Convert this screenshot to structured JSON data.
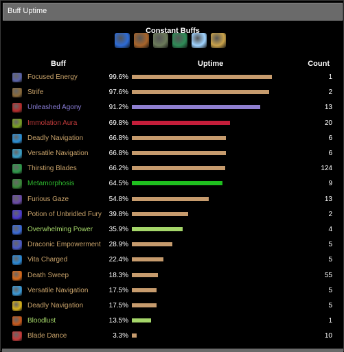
{
  "window": {
    "title": "Buff Uptime"
  },
  "constant": {
    "title": "Constant Buffs",
    "icons": [
      {
        "name": "arcane-swirl-icon",
        "color": "#2d6bd6"
      },
      {
        "name": "demon-face-icon",
        "color": "#a8642a"
      },
      {
        "name": "stone-pillar-icon",
        "color": "#6b7a5a"
      },
      {
        "name": "green-orb-icon",
        "color": "#2e8b57"
      },
      {
        "name": "ice-crystal-icon",
        "color": "#9fd3ff"
      },
      {
        "name": "golden-hoof-icon",
        "color": "#c9a24a"
      }
    ]
  },
  "table": {
    "headers": {
      "buff": "Buff",
      "uptime": "Uptime",
      "count": "Count"
    },
    "rows": [
      {
        "name": "Focused Energy",
        "pct": "99.6%",
        "count": "1",
        "uptime": 0.996,
        "name_color": "#c8a26a",
        "bar_color": "#c69b6d",
        "icon": "focused-energy-icon",
        "icon_color": "#5a63a8"
      },
      {
        "name": "Strife",
        "pct": "97.6%",
        "count": "2",
        "uptime": 0.976,
        "name_color": "#c8a26a",
        "bar_color": "#c69b6d",
        "icon": "strife-icon",
        "icon_color": "#8a6a3a"
      },
      {
        "name": "Unleashed Agony",
        "pct": "91.2%",
        "count": "13",
        "uptime": 0.912,
        "name_color": "#8a7ed8",
        "bar_color": "#8f7fd0",
        "icon": "unleashed-agony-icon",
        "icon_color": "#b52b2b"
      },
      {
        "name": "Immolation Aura",
        "pct": "69.8%",
        "count": "20",
        "uptime": 0.698,
        "name_color": "#c23b3b",
        "bar_color": "#c41e3a",
        "icon": "immolation-aura-icon",
        "icon_color": "#7aa024"
      },
      {
        "name": "Deadly Navigation",
        "pct": "66.8%",
        "count": "6",
        "uptime": 0.668,
        "name_color": "#c8a26a",
        "bar_color": "#c69b6d",
        "icon": "deadly-navigation-icon",
        "icon_color": "#2a8fd6"
      },
      {
        "name": "Versatile Navigation",
        "pct": "66.8%",
        "count": "6",
        "uptime": 0.668,
        "name_color": "#c8a26a",
        "bar_color": "#c69b6d",
        "icon": "versatile-navigation-icon",
        "icon_color": "#3aa0c8"
      },
      {
        "name": "Thirsting Blades",
        "pct": "66.2%",
        "count": "124",
        "uptime": 0.662,
        "name_color": "#c8a26a",
        "bar_color": "#c69b6d",
        "icon": "thirsting-blades-icon",
        "icon_color": "#2e9a4a"
      },
      {
        "name": "Metamorphosis",
        "pct": "64.5%",
        "count": "9",
        "uptime": 0.645,
        "name_color": "#2eb82e",
        "bar_color": "#1fbf1f",
        "icon": "metamorphosis-icon",
        "icon_color": "#3a8a3a"
      },
      {
        "name": "Furious Gaze",
        "pct": "54.8%",
        "count": "13",
        "uptime": 0.548,
        "name_color": "#c8a26a",
        "bar_color": "#c69b6d",
        "icon": "furious-gaze-icon",
        "icon_color": "#6a4aa8"
      },
      {
        "name": "Potion of Unbridled Fury",
        "pct": "39.8%",
        "count": "2",
        "uptime": 0.398,
        "name_color": "#c8a26a",
        "bar_color": "#c69b6d",
        "icon": "potion-icon",
        "icon_color": "#4a3ad0"
      },
      {
        "name": "Overwhelming Power",
        "pct": "35.9%",
        "count": "4",
        "uptime": 0.359,
        "name_color": "#a6d86a",
        "bar_color": "#a5d66a",
        "icon": "overwhelming-power-icon",
        "icon_color": "#3a6ad8"
      },
      {
        "name": "Draconic Empowerment",
        "pct": "28.9%",
        "count": "5",
        "uptime": 0.289,
        "name_color": "#c8a26a",
        "bar_color": "#c69b6d",
        "icon": "draconic-empowerment-icon",
        "icon_color": "#4a5ac8"
      },
      {
        "name": "Vita Charged",
        "pct": "22.4%",
        "count": "5",
        "uptime": 0.224,
        "name_color": "#c8a26a",
        "bar_color": "#c69b6d",
        "icon": "vita-charged-icon",
        "icon_color": "#2a8ad8"
      },
      {
        "name": "Death Sweep",
        "pct": "18.3%",
        "count": "55",
        "uptime": 0.183,
        "name_color": "#c8a26a",
        "bar_color": "#c69b6d",
        "icon": "death-sweep-icon",
        "icon_color": "#d86a1a"
      },
      {
        "name": "Versatile Navigation",
        "pct": "17.5%",
        "count": "5",
        "uptime": 0.175,
        "name_color": "#c8a26a",
        "bar_color": "#c69b6d",
        "icon": "versatile-navigation-icon",
        "icon_color": "#3a9ad8"
      },
      {
        "name": "Deadly Navigation",
        "pct": "17.5%",
        "count": "5",
        "uptime": 0.175,
        "name_color": "#c8a26a",
        "bar_color": "#c69b6d",
        "icon": "deadly-navigation-icon",
        "icon_color": "#d8b21a"
      },
      {
        "name": "Bloodlust",
        "pct": "13.5%",
        "count": "1",
        "uptime": 0.135,
        "name_color": "#a6d86a",
        "bar_color": "#a5d66a",
        "icon": "bloodlust-icon",
        "icon_color": "#c8581a"
      },
      {
        "name": "Blade Dance",
        "pct": "3.3%",
        "count": "10",
        "uptime": 0.033,
        "name_color": "#c8a26a",
        "bar_color": "#c69b6d",
        "icon": "blade-dance-icon",
        "icon_color": "#c83a3a"
      }
    ]
  }
}
